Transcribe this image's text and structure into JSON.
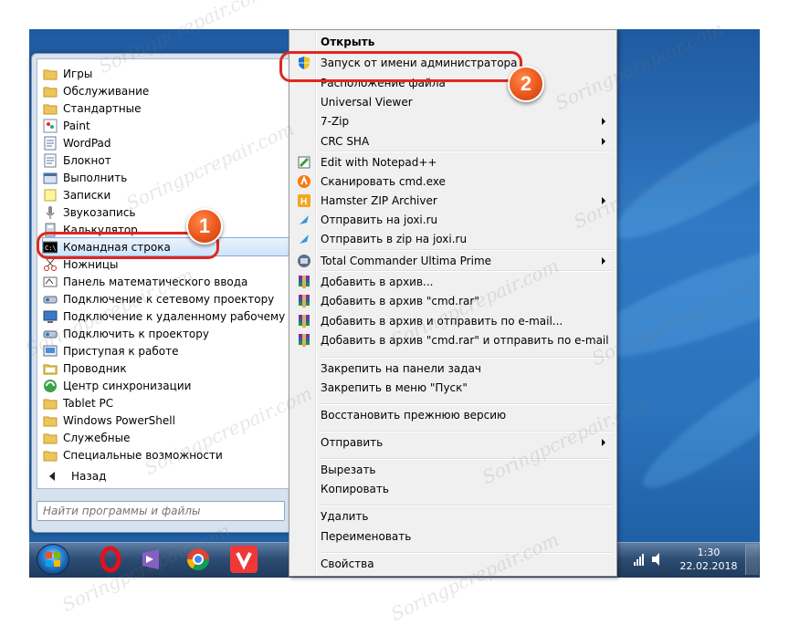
{
  "watermark": "Soringpcrepair.com",
  "programs": [
    {
      "label": "Игры",
      "icon": "folder-icon"
    },
    {
      "label": "Обслуживание",
      "icon": "folder-icon"
    },
    {
      "label": "Стандартные",
      "icon": "folder-open-icon"
    },
    {
      "label": "Paint",
      "icon": "paint-icon"
    },
    {
      "label": "WordPad",
      "icon": "wordpad-icon"
    },
    {
      "label": "Блокнот",
      "icon": "notepad-icon"
    },
    {
      "label": "Выполнить",
      "icon": "run-icon"
    },
    {
      "label": "Записки",
      "icon": "sticky-notes-icon"
    },
    {
      "label": "Звукозапись",
      "icon": "microphone-icon"
    },
    {
      "label": "Калькулятор",
      "icon": "calculator-icon"
    },
    {
      "label": "Командная строка",
      "icon": "cmd-icon"
    },
    {
      "label": "Ножницы",
      "icon": "scissors-icon"
    },
    {
      "label": "Панель математического ввода",
      "icon": "math-input-icon"
    },
    {
      "label": "Подключение к сетевому проектору",
      "icon": "network-projector-icon"
    },
    {
      "label": "Подключение к удаленному рабочему столу",
      "icon": "remote-desktop-icon"
    },
    {
      "label": "Подключить к проектору",
      "icon": "projector-icon"
    },
    {
      "label": "Приступая к работе",
      "icon": "getting-started-icon"
    },
    {
      "label": "Проводник",
      "icon": "explorer-icon"
    },
    {
      "label": "Центр синхронизации",
      "icon": "sync-center-icon"
    },
    {
      "label": "Tablet PC",
      "icon": "folder-icon"
    },
    {
      "label": "Windows PowerShell",
      "icon": "folder-icon"
    },
    {
      "label": "Служебные",
      "icon": "folder-icon"
    },
    {
      "label": "Специальные возможности",
      "icon": "folder-icon"
    }
  ],
  "back_label": "Назад",
  "search_placeholder": "Найти программы и файлы",
  "context_menu": [
    {
      "label": "Открыть",
      "icon": "",
      "bold": true,
      "submenu": false
    },
    {
      "label": "Запуск от имени администратора",
      "icon": "uac-shield-icon",
      "bold": false,
      "submenu": false
    },
    {
      "label": "Расположение файла",
      "icon": "",
      "bold": false,
      "submenu": false
    },
    {
      "label": "Universal Viewer",
      "icon": "",
      "bold": false,
      "submenu": false
    },
    {
      "label": "7-Zip",
      "icon": "",
      "bold": false,
      "submenu": true
    },
    {
      "label": "CRC SHA",
      "icon": "",
      "bold": false,
      "submenu": true
    },
    {
      "label": "Edit with Notepad++",
      "icon": "notepadpp-icon",
      "bold": false,
      "submenu": false
    },
    {
      "label": "Сканировать cmd.exe",
      "icon": "avast-icon",
      "bold": false,
      "submenu": false
    },
    {
      "label": "Hamster ZIP Archiver",
      "icon": "hamster-icon",
      "bold": false,
      "submenu": true
    },
    {
      "label": "Отправить на joxi.ru",
      "icon": "joxi-icon",
      "bold": false,
      "submenu": false
    },
    {
      "label": "Отправить в zip на joxi.ru",
      "icon": "joxi-icon",
      "bold": false,
      "submenu": false
    },
    {
      "label": "Total Commander Ultima Prime",
      "icon": "total-commander-icon",
      "bold": false,
      "submenu": true
    },
    {
      "label": "Добавить в архив...",
      "icon": "winrar-icon",
      "bold": false,
      "submenu": false
    },
    {
      "label": "Добавить в архив \"cmd.rar\"",
      "icon": "winrar-icon",
      "bold": false,
      "submenu": false
    },
    {
      "label": "Добавить в архив и отправить по e-mail...",
      "icon": "winrar-icon",
      "bold": false,
      "submenu": false
    },
    {
      "label": "Добавить в архив \"cmd.rar\" и отправить по e-mail",
      "icon": "winrar-icon",
      "bold": false,
      "submenu": false
    },
    {
      "label": "Закрепить на панели задач",
      "icon": "",
      "bold": false,
      "submenu": false
    },
    {
      "label": "Закрепить в меню \"Пуск\"",
      "icon": "",
      "bold": false,
      "submenu": false
    },
    {
      "label": "Восстановить прежнюю версию",
      "icon": "",
      "bold": false,
      "submenu": false
    },
    {
      "label": "Отправить",
      "icon": "",
      "bold": false,
      "submenu": true
    },
    {
      "label": "Вырезать",
      "icon": "",
      "bold": false,
      "submenu": false
    },
    {
      "label": "Копировать",
      "icon": "",
      "bold": false,
      "submenu": false
    },
    {
      "label": "Удалить",
      "icon": "",
      "bold": false,
      "submenu": false
    },
    {
      "label": "Переименовать",
      "icon": "",
      "bold": false,
      "submenu": false
    },
    {
      "label": "Свойства",
      "icon": "",
      "bold": false,
      "submenu": false
    }
  ],
  "callouts": {
    "one": "1",
    "two": "2"
  },
  "taskbar": {
    "apps": [
      "opera-icon",
      "visual-studio-icon",
      "chrome-icon",
      "vivaldi-icon"
    ],
    "time": "1:30",
    "date": "22.02.2018"
  },
  "colors": {
    "callout": "#ee5a1e",
    "highlight_ring": "#e0281f",
    "menu_bg": "#f0f0f0"
  }
}
